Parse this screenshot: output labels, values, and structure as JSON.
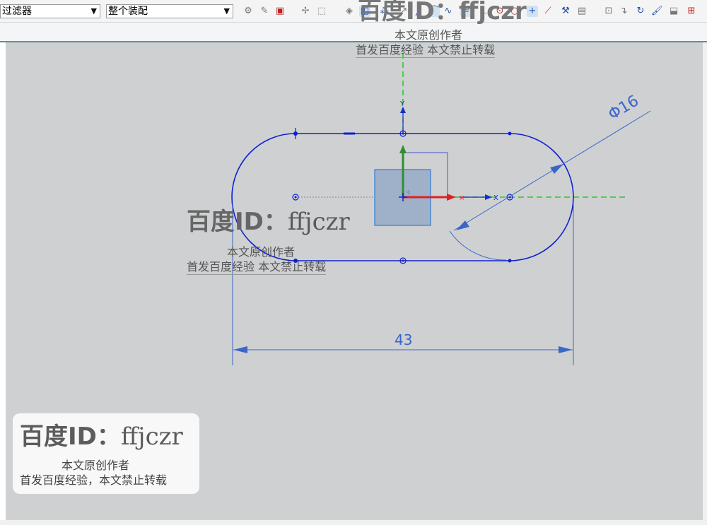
{
  "toolbar": {
    "filter_combo": "类型过滤器",
    "filter_combo_visible": "过滤器",
    "scope_combo": "整个装配",
    "dropdown_glyph": "▼"
  },
  "sketch": {
    "dimension_diameter": "Φ16",
    "dimension_length": "43",
    "axis_y_label": "Y",
    "axis_x_label": "X"
  },
  "watermarks": {
    "top": {
      "id_text": "百度ID：ffjczr",
      "line1": "本文原创作者",
      "line2": "首发百度经验   本文禁止转载"
    },
    "middle": {
      "id_prefix": "百度ID：",
      "id_name": "ffjczr",
      "line1": "本文原创作者",
      "line2": "首发百度经验   本文禁止转载"
    },
    "bottom": {
      "id_prefix": "百度ID：",
      "id_name": "ffjczr",
      "line1": "本文原创作者",
      "line2": "首发百度经验，本文禁止转载"
    }
  },
  "colors": {
    "canvas_bg": "#cfd0d2",
    "curve_blue": "#1020d0",
    "dimension_blue": "#3a66c8",
    "axis_green": "#22cc22",
    "axis_red": "#dd2222"
  }
}
